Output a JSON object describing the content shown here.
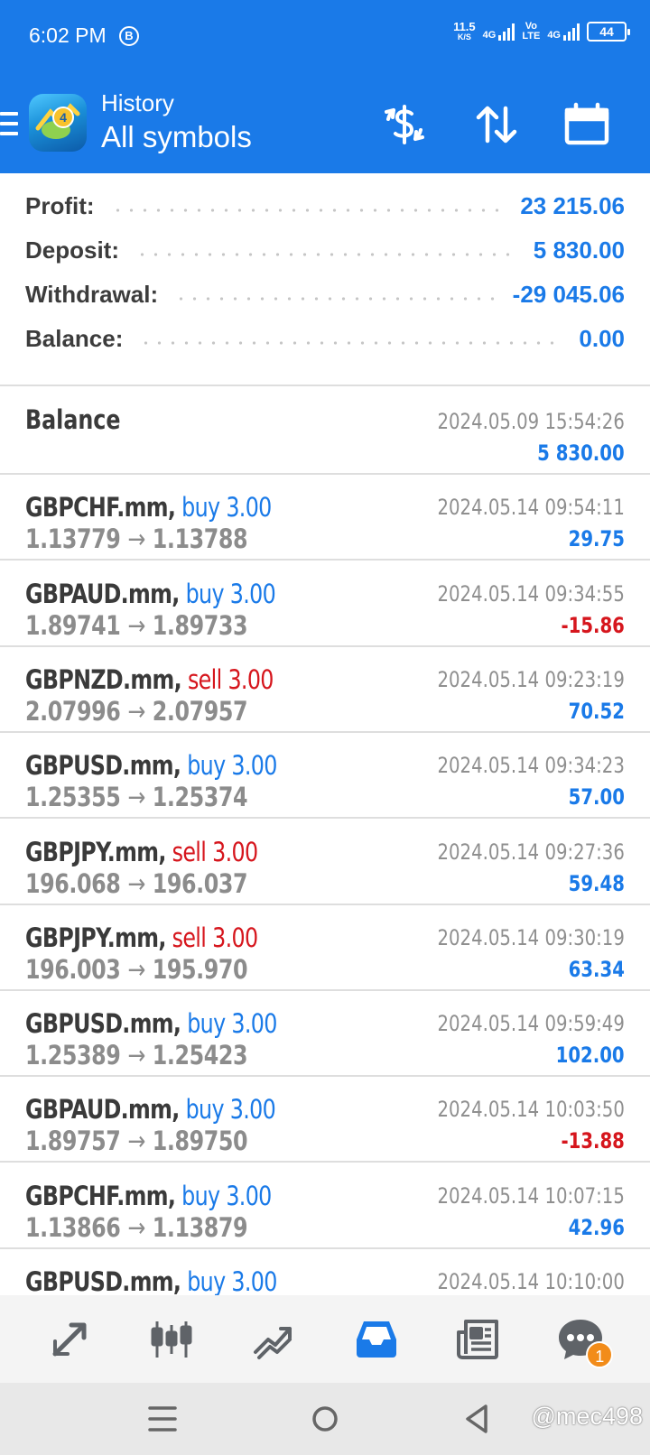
{
  "status_bar": {
    "time": "6:02 PM",
    "b_icon_letter": "B",
    "net_speed_value": "11.5",
    "net_speed_unit": "K/S",
    "sim1_label": "4G",
    "volte_label_1": "Vo",
    "volte_label_2": "LTE",
    "sim2_label": "4G",
    "battery": "44"
  },
  "header": {
    "section": "History",
    "filter": "All symbols",
    "logo_digit": "4"
  },
  "summary": [
    {
      "label": "Profit:",
      "value": "23 215.06"
    },
    {
      "label": "Deposit:",
      "value": "5 830.00"
    },
    {
      "label": "Withdrawal:",
      "value": "-29 045.06"
    },
    {
      "label": "Balance:",
      "value": "0.00"
    }
  ],
  "balance_entry": {
    "title": "Balance",
    "time": "2024.05.09 15:54:26",
    "amount": "5 830.00"
  },
  "arrow": "→",
  "trades": [
    {
      "symbol": "GBPCHF.mm,",
      "side": "buy 3.00",
      "type": "buy",
      "open": "1.13779",
      "close": "1.13788",
      "time": "2024.05.14 09:54:11",
      "profit": "29.75",
      "negative": false
    },
    {
      "symbol": "GBPAUD.mm,",
      "side": "buy 3.00",
      "type": "buy",
      "open": "1.89741",
      "close": "1.89733",
      "time": "2024.05.14 09:34:55",
      "profit": "-15.86",
      "negative": true
    },
    {
      "symbol": "GBPNZD.mm,",
      "side": "sell 3.00",
      "type": "sell",
      "open": "2.07996",
      "close": "2.07957",
      "time": "2024.05.14 09:23:19",
      "profit": "70.52",
      "negative": false
    },
    {
      "symbol": "GBPUSD.mm,",
      "side": "buy 3.00",
      "type": "buy",
      "open": "1.25355",
      "close": "1.25374",
      "time": "2024.05.14 09:34:23",
      "profit": "57.00",
      "negative": false
    },
    {
      "symbol": "GBPJPY.mm,",
      "side": "sell 3.00",
      "type": "sell",
      "open": "196.068",
      "close": "196.037",
      "time": "2024.05.14 09:27:36",
      "profit": "59.48",
      "negative": false
    },
    {
      "symbol": "GBPJPY.mm,",
      "side": "sell 3.00",
      "type": "sell",
      "open": "196.003",
      "close": "195.970",
      "time": "2024.05.14 09:30:19",
      "profit": "63.34",
      "negative": false
    },
    {
      "symbol": "GBPUSD.mm,",
      "side": "buy 3.00",
      "type": "buy",
      "open": "1.25389",
      "close": "1.25423",
      "time": "2024.05.14 09:59:49",
      "profit": "102.00",
      "negative": false
    },
    {
      "symbol": "GBPAUD.mm,",
      "side": "buy 3.00",
      "type": "buy",
      "open": "1.89757",
      "close": "1.89750",
      "time": "2024.05.14 10:03:50",
      "profit": "-13.88",
      "negative": true
    },
    {
      "symbol": "GBPCHF.mm,",
      "side": "buy 3.00",
      "type": "buy",
      "open": "1.13866",
      "close": "1.13879",
      "time": "2024.05.14 10:07:15",
      "profit": "42.96",
      "negative": false
    },
    {
      "symbol": "GBPUSD.mm,",
      "side": "buy 3.00",
      "type": "buy",
      "open": "",
      "close": "",
      "time": "2024.05.14 10:10:00",
      "profit": "",
      "negative": false
    }
  ],
  "bottom_nav": {
    "items": [
      "quotes-icon",
      "chart-icon",
      "trade-icon",
      "history-icon",
      "news-icon",
      "messages-icon"
    ],
    "active": "history-icon",
    "messages_badge": "1"
  },
  "watermark": "@mec498",
  "colors": {
    "accent": "#1a7ae8",
    "negative": "#d6161d",
    "badge": "#f28c1a"
  }
}
